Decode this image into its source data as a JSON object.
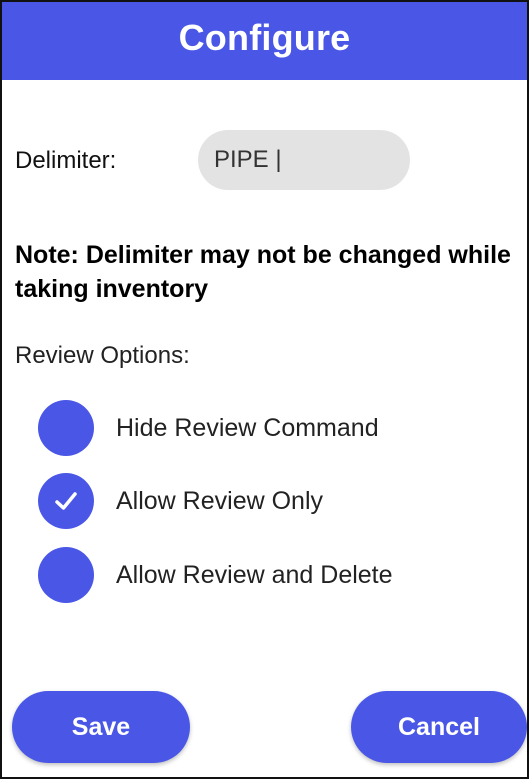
{
  "header": {
    "title": "Configure"
  },
  "delimiter": {
    "label": "Delimiter:",
    "value": "PIPE |"
  },
  "note": {
    "text": "Note: Delimiter may not be changed while taking inventory"
  },
  "review_options": {
    "title": "Review Options:",
    "items": [
      {
        "label": "Hide Review Command",
        "selected": false
      },
      {
        "label": "Allow Review Only",
        "selected": true
      },
      {
        "label": "Allow Review and Delete",
        "selected": false
      }
    ]
  },
  "buttons": {
    "save": "Save",
    "cancel": "Cancel"
  },
  "colors": {
    "accent": "#4a57e6",
    "input_bg": "#e3e3e3"
  },
  "icons": {
    "checkmark": "checkmark-icon"
  }
}
